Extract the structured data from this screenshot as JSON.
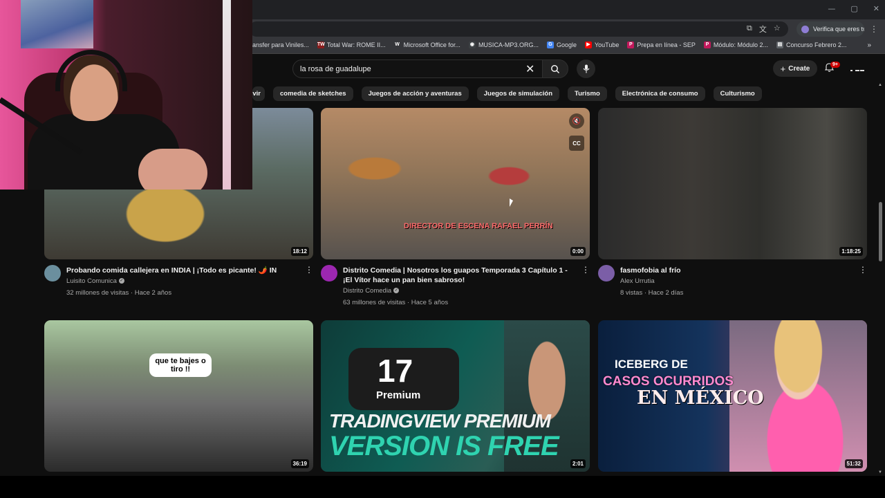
{
  "browser": {
    "profile_label": "Verifica que eres tú",
    "bookmarks": [
      {
        "label": "ransfer para Viniles...",
        "color": "#5f6368",
        "glyph": ""
      },
      {
        "label": "Total War: ROME II...",
        "color": "#8a1c1c",
        "glyph": "TW"
      },
      {
        "label": "Microsoft Office for...",
        "color": "#35363a",
        "glyph": "W"
      },
      {
        "label": "MUSICA-MP3.ORG...",
        "color": "#3c4043",
        "glyph": "◉"
      },
      {
        "label": "Google",
        "color": "#4285f4",
        "glyph": "G"
      },
      {
        "label": "YouTube",
        "color": "#ff0000",
        "glyph": "▶"
      },
      {
        "label": "Prepa en línea - SEP",
        "color": "#c2185b",
        "glyph": "P"
      },
      {
        "label": "Módulo: Módulo 2...",
        "color": "#c2185b",
        "glyph": "P"
      },
      {
        "label": "Concurso Febrero 2...",
        "color": "#5f6368",
        "glyph": "▤"
      }
    ],
    "more_bookmarks": "»"
  },
  "header": {
    "search_query": "la rosa de guadalupe",
    "create_label": "Create",
    "notifications_count": "9+"
  },
  "chips": [
    "vir",
    "comedia de sketches",
    "Juegos de acción y aventuras",
    "Juegos de simulación",
    "Turismo",
    "Electrónica de consumo",
    "Culturismo"
  ],
  "videos": [
    {
      "title": "Probando comida callejera en INDIA | ¡Todo es picante! 🌶️ IN",
      "channel": "Luisito Comunica",
      "verified": true,
      "stats": "32 millones de visitas · Hace 2 años",
      "duration": "18:12",
      "avatar_color": "#6b8f9e"
    },
    {
      "title": "Distrito Comedia | Nosotros los guapos Temporada 3 Capítulo 1 - ¡El Vítor hace un pan bien sabroso!",
      "channel": "Distrito Comedia",
      "verified": true,
      "stats": "63 millones de visitas · Hace 5 años",
      "duration": "0:00",
      "avatar_color": "#9c27b0",
      "caption": "DIRECTOR DE ESCENA RAFAEL PERRÍN"
    },
    {
      "title": "fasmofobia al frío",
      "channel": "Alex Urrutia",
      "verified": false,
      "stats": "8 vistas · Hace 2 días",
      "duration": "1:18:25",
      "avatar_color": "#7b5ea7"
    },
    {
      "duration": "36:19",
      "bubble": "que te bajes o tiro !!"
    },
    {
      "duration": "2:01",
      "line1": "TRADINGVIEW PREMIUM",
      "line2": "VERSION IS FREE",
      "logo_word": "Premium",
      "logo_mark": "17"
    },
    {
      "duration": "51:32",
      "line1": "ICEBERG DE",
      "line2": "CASOS OCURRIDOS",
      "line3": "EN MÉXICO"
    }
  ]
}
